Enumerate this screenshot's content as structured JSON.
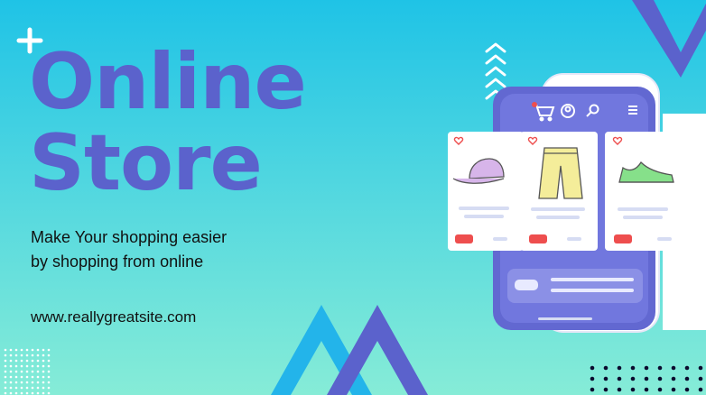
{
  "headline": {
    "line1": "Online",
    "line2": "Store"
  },
  "tagline": {
    "line1": "Make Your shopping easier",
    "line2": "by shopping from online"
  },
  "website": "www.reallygreatsite.com",
  "colors": {
    "background_top": "#1fc3e6",
    "background_bottom": "#86ecd7",
    "brand_purple": "#5b62cc",
    "accent_red": "#ee4e4e",
    "card_white": "#ffffff"
  },
  "phone": {
    "icons": [
      "cart-icon",
      "user-icon",
      "search-icon",
      "menu-icon"
    ],
    "products": [
      {
        "name": "cap",
        "icon": "cap-icon"
      },
      {
        "name": "shorts",
        "icon": "shorts-icon"
      },
      {
        "name": "sneaker",
        "icon": "sneaker-icon"
      }
    ]
  }
}
